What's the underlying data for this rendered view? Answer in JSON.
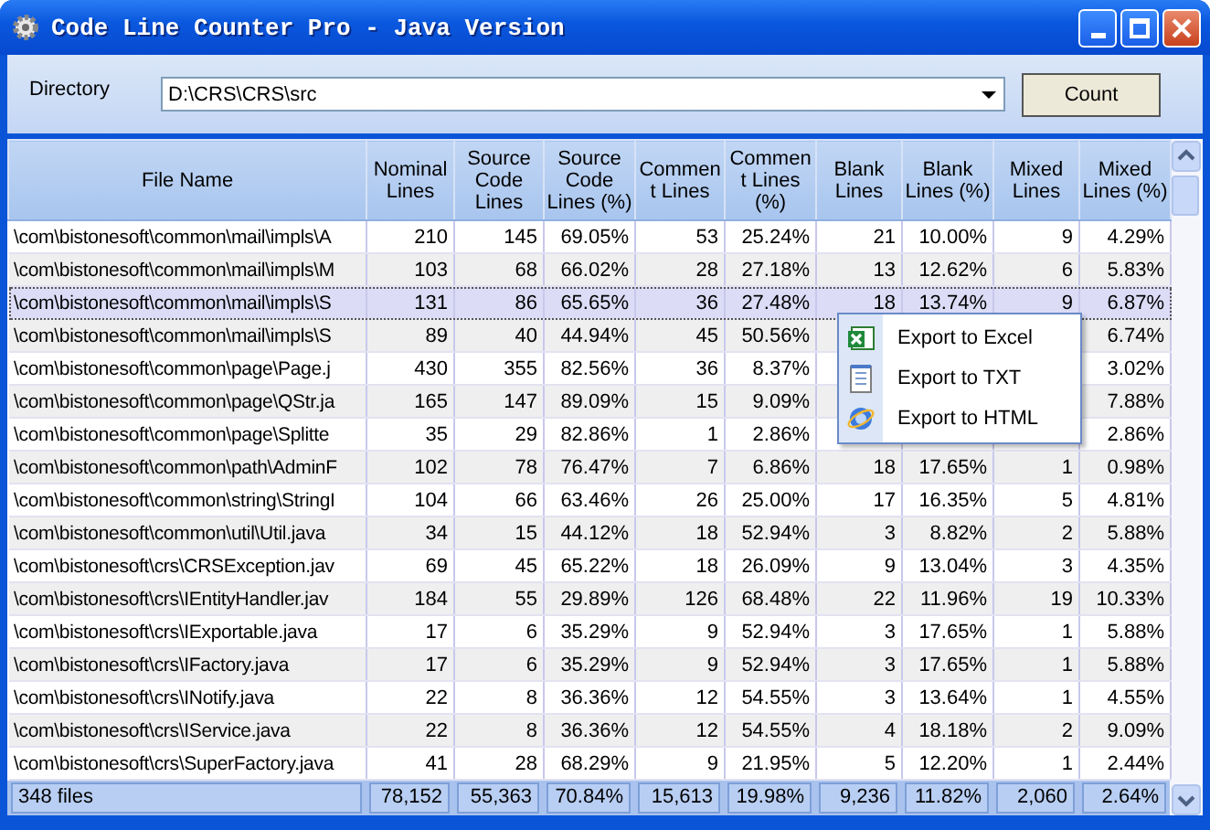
{
  "window": {
    "title": "Code Line Counter Pro - Java Version"
  },
  "directory": {
    "label": "Directory",
    "value": "D:\\CRS\\CRS\\src"
  },
  "count_button": "Count",
  "table": {
    "columns": [
      "File Name",
      "Nominal Lines",
      "Source Code Lines",
      "Source Code Lines (%)",
      "Comment Lines",
      "Comment Lines (%)",
      "Blank Lines",
      "Blank Lines (%)",
      "Mixed Lines",
      "Mixed Lines (%)"
    ],
    "rows": [
      {
        "selected": false,
        "cells": [
          "\\com\\bistonesoft\\common\\mail\\impls\\A",
          "210",
          "145",
          "69.05%",
          "53",
          "25.24%",
          "21",
          "10.00%",
          "9",
          "4.29%"
        ]
      },
      {
        "selected": false,
        "cells": [
          "\\com\\bistonesoft\\common\\mail\\impls\\M",
          "103",
          "68",
          "66.02%",
          "28",
          "27.18%",
          "13",
          "12.62%",
          "6",
          "5.83%"
        ]
      },
      {
        "selected": true,
        "cells": [
          "\\com\\bistonesoft\\common\\mail\\impls\\S",
          "131",
          "86",
          "65.65%",
          "36",
          "27.48%",
          "18",
          "13.74%",
          "9",
          "6.87%"
        ]
      },
      {
        "selected": false,
        "cells": [
          "\\com\\bistonesoft\\common\\mail\\impls\\S",
          "89",
          "40",
          "44.94%",
          "45",
          "50.56%",
          null,
          null,
          null,
          "6.74%"
        ]
      },
      {
        "selected": false,
        "cells": [
          "\\com\\bistonesoft\\common\\page\\Page.j",
          "430",
          "355",
          "82.56%",
          "36",
          "8.37%",
          null,
          null,
          null,
          "3.02%"
        ]
      },
      {
        "selected": false,
        "cells": [
          "\\com\\bistonesoft\\common\\page\\QStr.ja",
          "165",
          "147",
          "89.09%",
          "15",
          "9.09%",
          null,
          null,
          null,
          "7.88%"
        ]
      },
      {
        "selected": false,
        "cells": [
          "\\com\\bistonesoft\\common\\page\\Splitte",
          "35",
          "29",
          "82.86%",
          "1",
          "2.86%",
          null,
          null,
          null,
          "2.86%"
        ]
      },
      {
        "selected": false,
        "cells": [
          "\\com\\bistonesoft\\common\\path\\AdminF",
          "102",
          "78",
          "76.47%",
          "7",
          "6.86%",
          "18",
          "17.65%",
          "1",
          "0.98%"
        ]
      },
      {
        "selected": false,
        "cells": [
          "\\com\\bistonesoft\\common\\string\\StringI",
          "104",
          "66",
          "63.46%",
          "26",
          "25.00%",
          "17",
          "16.35%",
          "5",
          "4.81%"
        ]
      },
      {
        "selected": false,
        "cells": [
          "\\com\\bistonesoft\\common\\util\\Util.java",
          "34",
          "15",
          "44.12%",
          "18",
          "52.94%",
          "3",
          "8.82%",
          "2",
          "5.88%"
        ]
      },
      {
        "selected": false,
        "cells": [
          "\\com\\bistonesoft\\crs\\CRSException.jav",
          "69",
          "45",
          "65.22%",
          "18",
          "26.09%",
          "9",
          "13.04%",
          "3",
          "4.35%"
        ]
      },
      {
        "selected": false,
        "cells": [
          "\\com\\bistonesoft\\crs\\IEntityHandler.jav",
          "184",
          "55",
          "29.89%",
          "126",
          "68.48%",
          "22",
          "11.96%",
          "19",
          "10.33%"
        ]
      },
      {
        "selected": false,
        "cells": [
          "\\com\\bistonesoft\\crs\\IExportable.java",
          "17",
          "6",
          "35.29%",
          "9",
          "52.94%",
          "3",
          "17.65%",
          "1",
          "5.88%"
        ]
      },
      {
        "selected": false,
        "cells": [
          "\\com\\bistonesoft\\crs\\IFactory.java",
          "17",
          "6",
          "35.29%",
          "9",
          "52.94%",
          "3",
          "17.65%",
          "1",
          "5.88%"
        ]
      },
      {
        "selected": false,
        "cells": [
          "\\com\\bistonesoft\\crs\\INotify.java",
          "22",
          "8",
          "36.36%",
          "12",
          "54.55%",
          "3",
          "13.64%",
          "1",
          "4.55%"
        ]
      },
      {
        "selected": false,
        "cells": [
          "\\com\\bistonesoft\\crs\\IService.java",
          "22",
          "8",
          "36.36%",
          "12",
          "54.55%",
          "4",
          "18.18%",
          "2",
          "9.09%"
        ]
      },
      {
        "selected": false,
        "cells": [
          "\\com\\bistonesoft\\crs\\SuperFactory.java",
          "41",
          "28",
          "68.29%",
          "9",
          "21.95%",
          "5",
          "12.20%",
          "1",
          "2.44%"
        ]
      }
    ],
    "footer": [
      "348 files",
      "78,152",
      "55,363",
      "70.84%",
      "15,613",
      "19.98%",
      "9,236",
      "11.82%",
      "2,060",
      "2.64%"
    ]
  },
  "context_menu": {
    "items": [
      {
        "label": "Export to Excel",
        "kind": "excel"
      },
      {
        "label": "Export to TXT",
        "kind": "txt"
      },
      {
        "label": "Export to HTML",
        "kind": "html"
      }
    ]
  }
}
